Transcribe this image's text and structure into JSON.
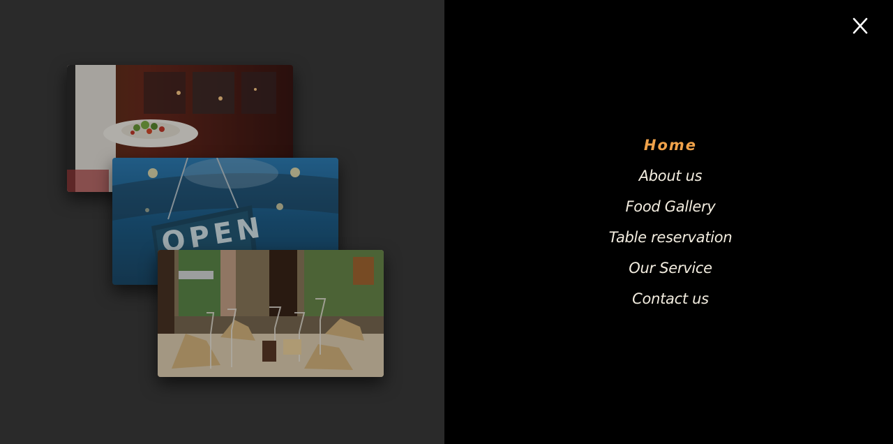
{
  "nav": {
    "items": [
      {
        "label": "Home",
        "active": true
      },
      {
        "label": "About us",
        "active": false
      },
      {
        "label": "Food Gallery",
        "active": false
      },
      {
        "label": "Table reservation",
        "active": false
      },
      {
        "label": "Our Service",
        "active": false
      },
      {
        "label": "Contact us",
        "active": false
      }
    ],
    "accent_color": "#f0a24a",
    "text_color": "#f3ede0"
  },
  "close_icon": "close-icon",
  "gallery": {
    "sign_text": "OPEN",
    "photos": [
      {
        "subject": "waiter-serving-salad-plate"
      },
      {
        "subject": "open-sign-on-door"
      },
      {
        "subject": "restaurant-table-setting"
      }
    ]
  },
  "colors": {
    "left_panel": "#2a2a2a",
    "right_panel": "#000000"
  }
}
